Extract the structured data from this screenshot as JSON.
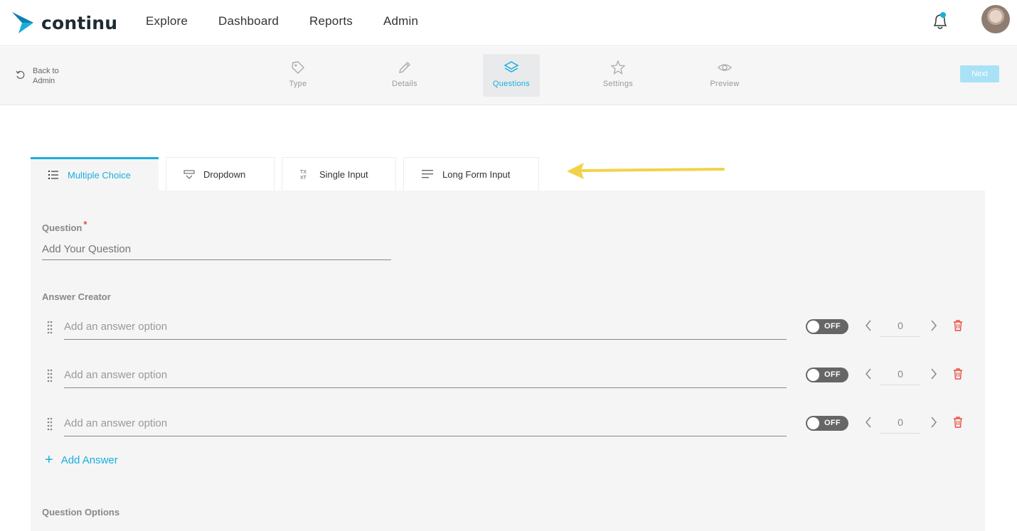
{
  "header": {
    "logo_text": "continu",
    "nav": [
      "Explore",
      "Dashboard",
      "Reports",
      "Admin"
    ],
    "notification_dot_color": "#1aaedf"
  },
  "stepbar": {
    "back_label": "Back to Admin",
    "steps": [
      {
        "label": "Type",
        "icon": "tag-icon"
      },
      {
        "label": "Details",
        "icon": "pencil-icon"
      },
      {
        "label": "Questions",
        "icon": "layers-icon",
        "active": true
      },
      {
        "label": "Settings",
        "icon": "star-icon"
      },
      {
        "label": "Preview",
        "icon": "eye-icon"
      }
    ],
    "next_label": "Next"
  },
  "tabs": [
    {
      "label": "Multiple Choice",
      "icon": "list-icon",
      "active": true
    },
    {
      "label": "Dropdown",
      "icon": "dropdown-icon"
    },
    {
      "label": "Single Input",
      "icon": "text-format-icon"
    },
    {
      "label": "Long Form Input",
      "icon": "paragraph-icon"
    }
  ],
  "form": {
    "question_label": "Question",
    "required_mark": "*",
    "question_placeholder": "Add Your Question",
    "answer_creator_label": "Answer Creator",
    "answers": [
      {
        "placeholder": "Add an answer option",
        "toggle": "OFF",
        "points": "0"
      },
      {
        "placeholder": "Add an answer option",
        "toggle": "OFF",
        "points": "0"
      },
      {
        "placeholder": "Add an answer option",
        "toggle": "OFF",
        "points": "0"
      }
    ],
    "add_answer_label": "Add Answer",
    "question_options_label": "Question Options"
  },
  "colors": {
    "accent": "#1aaedf",
    "next_button": "#a9e2f6",
    "delete": "#e84c3d",
    "annotation_arrow": "#f2d24a"
  }
}
